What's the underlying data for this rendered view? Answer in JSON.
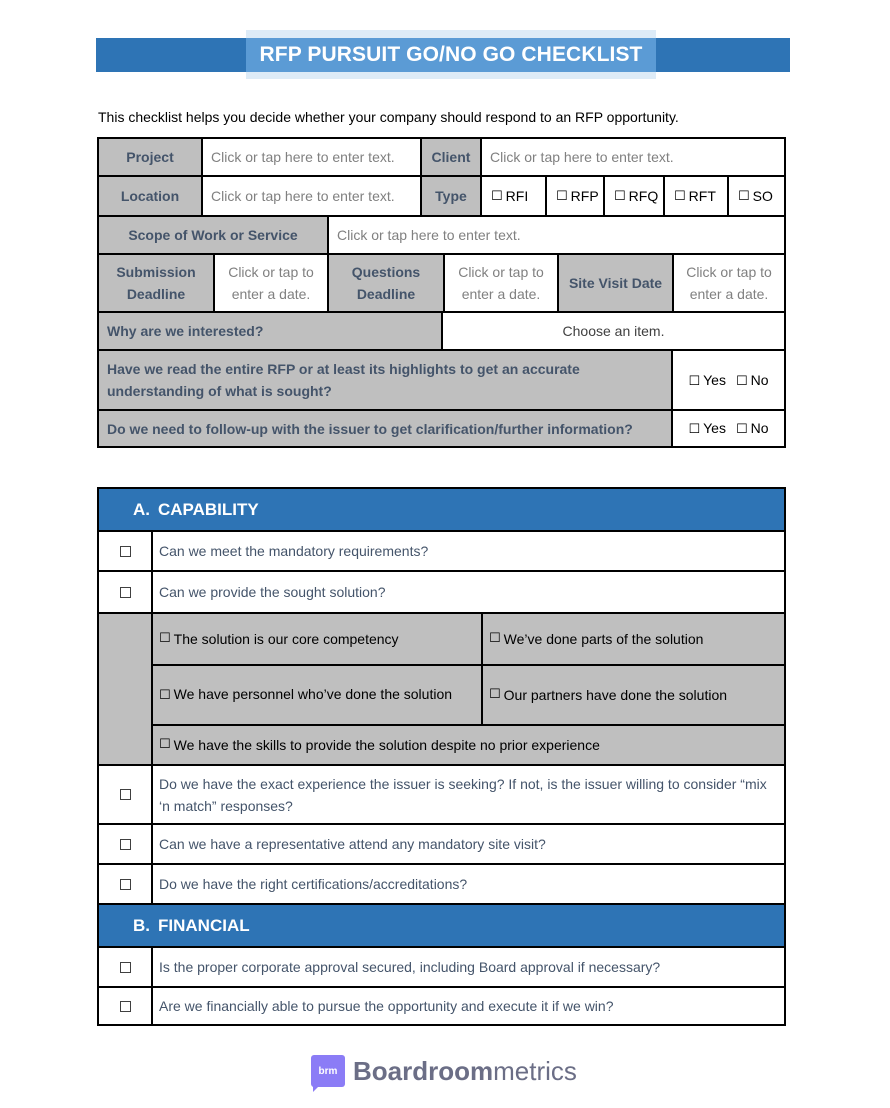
{
  "title": "RFP PURSUIT GO/NO GO CHECKLIST",
  "intro": "This checklist helps you decide whether your company should respond to an RFP opportunity.",
  "colors": {
    "header_blue": "#2E74B5",
    "title_highlight": "#5B9BD5",
    "label_grey": "#BFBFBF",
    "label_text": "#44546A",
    "placeholder_text": "#808080",
    "logo_purple": "#8B7CF6"
  },
  "form": {
    "project": {
      "label": "Project",
      "placeholder": "Click or tap here to enter text."
    },
    "client": {
      "label": "Client",
      "placeholder": "Click or tap here to enter text."
    },
    "location": {
      "label": "Location",
      "placeholder": "Click or tap here to enter text."
    },
    "type": {
      "label": "Type",
      "options": [
        "RFI",
        "RFP",
        "RFQ",
        "RFT",
        "SO"
      ]
    },
    "scope": {
      "label": "Scope of Work or Service",
      "placeholder": "Click or tap here to enter text."
    },
    "submission_deadline": {
      "label_line1": "Submission",
      "label_line2": "Deadline",
      "placeholder_line1": "Click or tap to",
      "placeholder_line2": "enter a date."
    },
    "questions_deadline": {
      "label_line1": "Questions",
      "label_line2": "Deadline",
      "placeholder_line1": "Click or tap to",
      "placeholder_line2": "enter a date."
    },
    "site_visit_date": {
      "label": "Site Visit Date",
      "placeholder_line1": "Click or tap to",
      "placeholder_line2": "enter a date."
    },
    "why_interested": {
      "label": "Why are we interested?",
      "selected": "Choose an item."
    },
    "read_rfp": {
      "question": "Have we read the entire RFP or at least its highlights to get an accurate understanding of what is sought?",
      "yes": "Yes",
      "no": "No"
    },
    "follow_up": {
      "question": "Do we need to follow-up with the issuer to get clarification/further information?",
      "yes": "Yes",
      "no": "No"
    }
  },
  "sections": {
    "capability": {
      "letter": "A.",
      "title": "CAPABILITY",
      "items": [
        "Can we meet the mandatory requirements?",
        "Can we provide the sought solution?"
      ],
      "sub_options": [
        "The solution is our core competency",
        "We’ve done parts of the solution",
        "We have personnel who’ve done the solution",
        "Our partners have done the solution",
        "We have the skills to provide the solution despite no prior experience"
      ],
      "items_after": [
        "Do we have the exact experience the issuer is seeking? If not, is the issuer willing to consider “mix ‘n match” responses?",
        "Can we have a representative attend any mandatory site visit?",
        "Do we have the right certifications/accreditations?"
      ]
    },
    "financial": {
      "letter": "B.",
      "title": "FINANCIAL",
      "items": [
        "Is the proper corporate approval secured, including Board approval if necessary?",
        "Are we financially able to pursue the opportunity and execute it if we win?"
      ]
    }
  },
  "logo": {
    "badge": "brm",
    "text_bold": "Boardroom",
    "text_light": "metrics"
  }
}
